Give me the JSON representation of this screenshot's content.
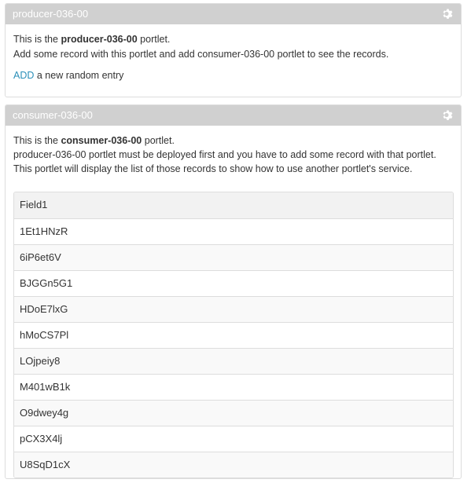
{
  "producer": {
    "title": "producer-036-00",
    "line1_prefix": "This is the ",
    "line1_name": "producer-036-00",
    "line1_suffix": " portlet.",
    "line2": "Add some record with this portlet and add consumer-036-00 portlet to see the records.",
    "add_link": "ADD",
    "add_suffix": " a new random entry",
    "settings_icon": "gear-icon"
  },
  "consumer": {
    "title": "consumer-036-00",
    "line1_prefix": "This is the ",
    "line1_name": "consumer-036-00",
    "line1_suffix": " portlet.",
    "line2": "producer-036-00 portlet must be deployed first and you have to add some record with that portlet.",
    "line3": "This portlet will display the list of those records to show how to use another portlet's service.",
    "settings_icon": "gear-icon",
    "table": {
      "header": "Field1",
      "rows": [
        "1Et1HNzR",
        "6iP6et6V",
        "BJGGn5G1",
        "HDoE7lxG",
        "hMoCS7Pl",
        "LOjpeiy8",
        "M401wB1k",
        "O9dwey4g",
        "pCX3X4lj",
        "U8SqD1cX"
      ]
    }
  },
  "colors": {
    "header_bg": "#d0d0d0",
    "link": "#2b8fb8",
    "border": "#dddddd"
  }
}
